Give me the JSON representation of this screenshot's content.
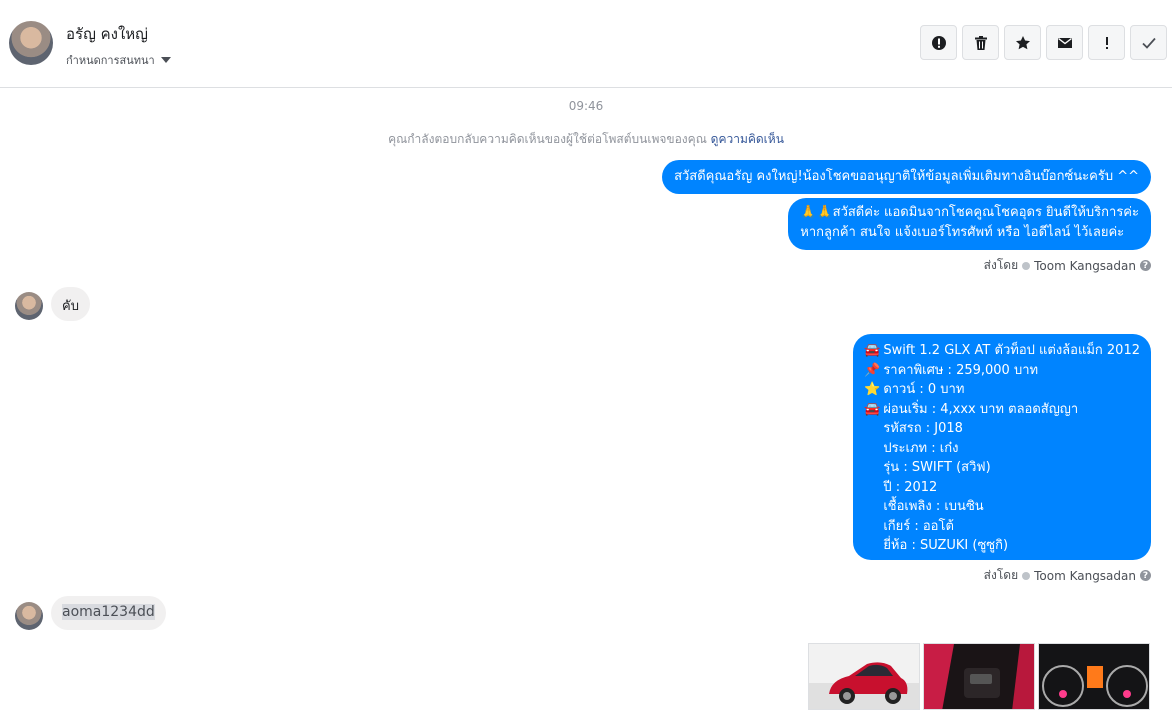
{
  "header": {
    "contact_name": "อรัญ คงใหญ่",
    "assign_label": "กำหนดการสนทนา",
    "actions": [
      {
        "name": "report-spam-icon"
      },
      {
        "name": "trash-icon"
      },
      {
        "name": "star-icon"
      },
      {
        "name": "mail-icon"
      },
      {
        "name": "important-icon"
      },
      {
        "name": "check-icon"
      }
    ]
  },
  "thread": {
    "timestamp": "09:46",
    "notice_text": "คุณกำลังตอบกลับความคิดเห็นของผู้ใช้ต่อโพสต์บนเพจของคุณ",
    "notice_link": "ดูความคิดเห็น",
    "msg1": "สวัสดีคุณอรัญ คงใหญ่!น้องโชคขออนุญาติให้ข้อมูลเพิ่มเติมทางอินบ๊อกซ์นะครับ ^^",
    "msg2_line1": "🙏🙏สวัสดีค่ะ แอดมินจากโชคคูณโชคอุดร ยินดีให้บริการค่ะ",
    "msg2_line2": "หากลูกค้า สนใจ แจ้งเบอร์โทรศัพท์ หรือ ไอดีไลน์  ไว้เลยค่ะ",
    "sent_by_label": "ส่งโดย",
    "sender": "Toom Kangsadan",
    "reply1": "คับ",
    "car_lines": [
      {
        "icon": "🚘",
        "text": "Swift 1.2 GLX AT ตัวท็อป แต่งล้อแม็ก 2012"
      },
      {
        "icon": "📌",
        "text": "ราคาพิเศษ : 259,000 บาท"
      },
      {
        "icon": "⭐",
        "text": "ดาวน์ : 0 บาท"
      },
      {
        "icon": "🚘",
        "text": "ผ่อนเริ่ม : 4,xxx บาท ตลอดสัญญา"
      },
      {
        "icon": "",
        "text": "รหัสรถ : J018"
      },
      {
        "icon": "",
        "text": "ประเภท : เก๋ง"
      },
      {
        "icon": "",
        "text": "รุ่น : SWIFT (สวิฟ)"
      },
      {
        "icon": "",
        "text": "ปี : 2012"
      },
      {
        "icon": "",
        "text": "เชื้อเพลิง : เบนซิน"
      },
      {
        "icon": "",
        "text": "เกียร์ : ออโต้"
      },
      {
        "icon": "",
        "text": "ยี่ห้อ : SUZUKI (ซูซูกิ)"
      }
    ],
    "reply2": "aoma1234dd",
    "images": [
      {
        "name": "car-exterior-photo"
      },
      {
        "name": "car-door-interior-photo"
      },
      {
        "name": "car-dashboard-photo"
      }
    ]
  }
}
